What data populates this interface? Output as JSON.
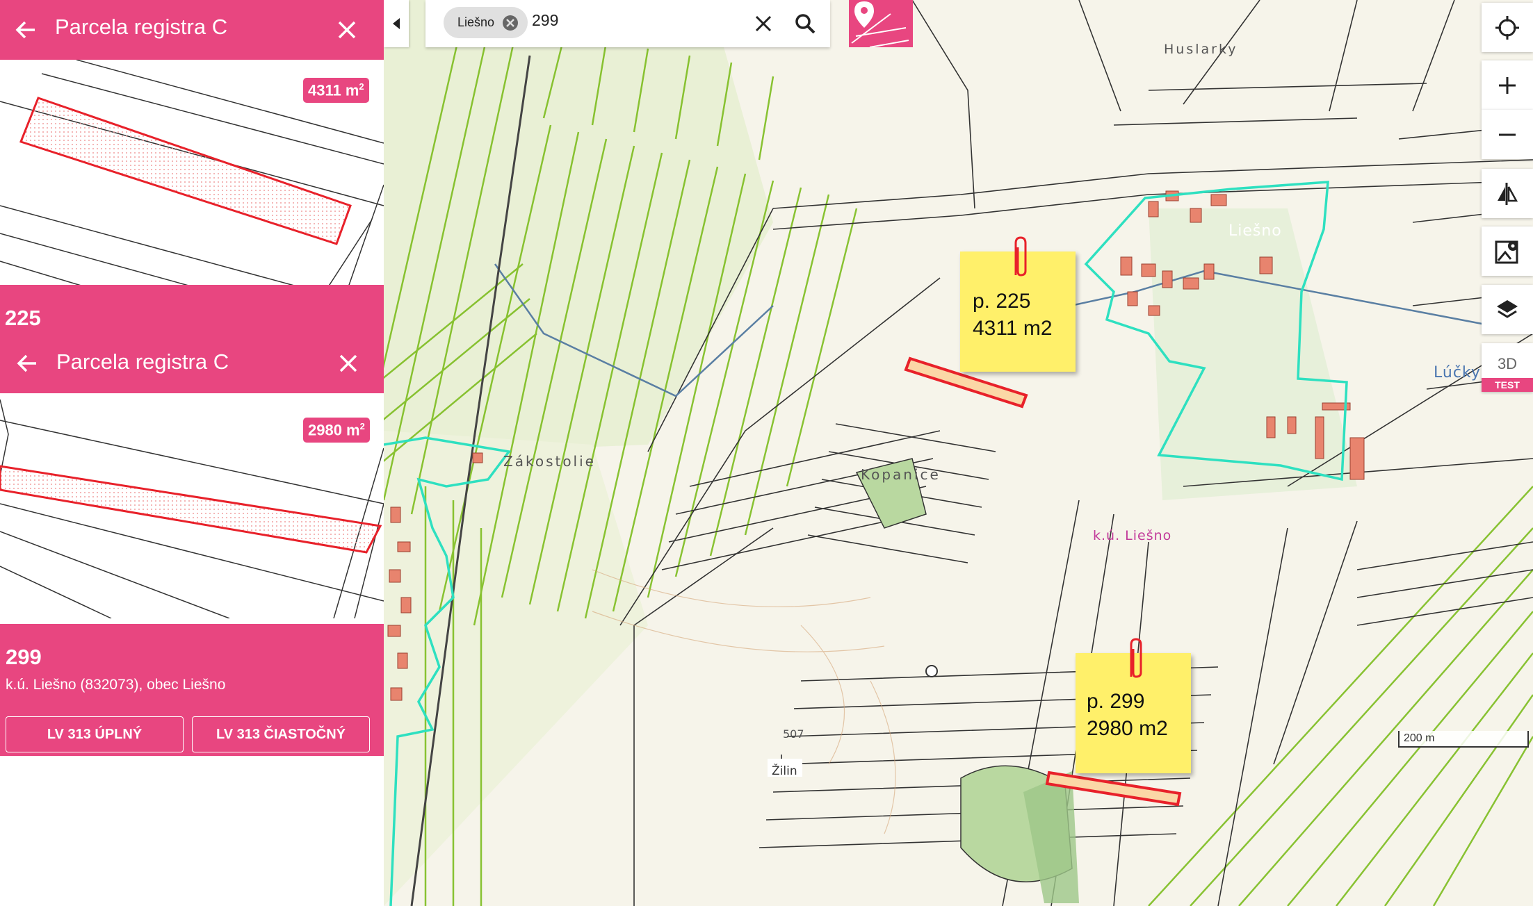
{
  "panel1": {
    "title": "Parcela registra C",
    "area_value": "4311 m",
    "area_sup": "2"
  },
  "panel2": {
    "number": "225",
    "title": "Parcela registra C",
    "area_value": "2980 m",
    "area_sup": "2"
  },
  "panel3": {
    "number": "299",
    "subtitle": "k.ú. Liešno (832073), obec Liešno",
    "btn_full": "LV 313 ÚPLNÝ",
    "btn_partial": "LV 313 ČIASTOČNÝ"
  },
  "search": {
    "chip_label": "Liešno",
    "query": "299"
  },
  "map_labels": {
    "huslarky": "Huslarky",
    "zakostolie": "Zákostolie",
    "kopanice": "Kopanice",
    "ku": "k.ú. Liešno",
    "lucky": "Lúčky",
    "village": "Liešno",
    "elev": "507",
    "zilina": "Žilin"
  },
  "notes": [
    {
      "line1": "p. 225",
      "line2": "4311 m2"
    },
    {
      "line1": "p. 299",
      "line2": "2980 m2"
    }
  ],
  "controls": {
    "btn_3d": "3D",
    "test": "TEST"
  },
  "scale": "200 m",
  "colors": {
    "accent": "#e84680",
    "parcel_green": "#7dbd1f",
    "boundary_cyan": "#2ee0c0",
    "highlight_red": "#e8212a"
  }
}
